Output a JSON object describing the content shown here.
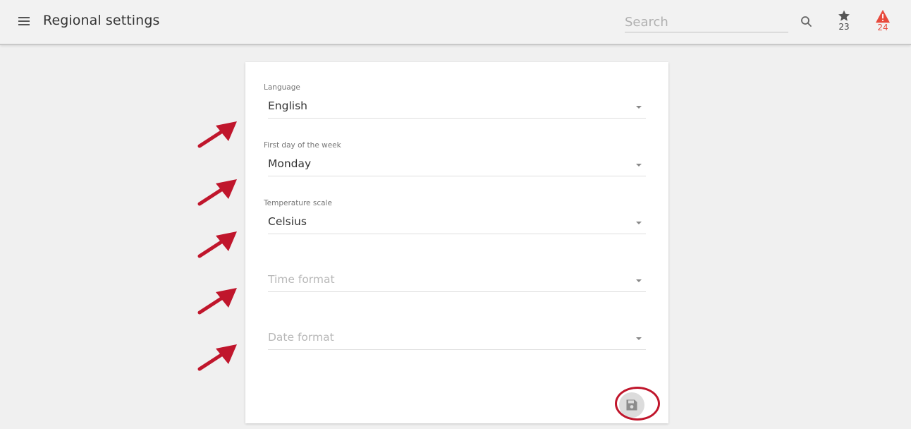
{
  "header": {
    "title": "Regional settings",
    "search_placeholder": "Search",
    "favorites_count": "23",
    "alarms_count": "24"
  },
  "form": {
    "fields": [
      {
        "label": "Language",
        "value": "English"
      },
      {
        "label": "First day of the week",
        "value": "Monday"
      },
      {
        "label": "Temperature scale",
        "value": "Celsius"
      },
      {
        "label": "",
        "placeholder": "Time format"
      },
      {
        "label": "",
        "placeholder": "Date format"
      }
    ]
  },
  "icons": {
    "menu": "menu-icon",
    "search": "search-icon",
    "favorites": "star-icon",
    "alarms": "warning-icon",
    "select": "caret-down-icon",
    "save": "floppy-disk-icon",
    "annotation": "arrow-annotation-icon"
  },
  "colors": {
    "background": "#f0f0f0",
    "card": "#ffffff",
    "alarm": "#e84a3c",
    "annotation": "#c0162c",
    "placeholder": "#b8b8b8"
  }
}
